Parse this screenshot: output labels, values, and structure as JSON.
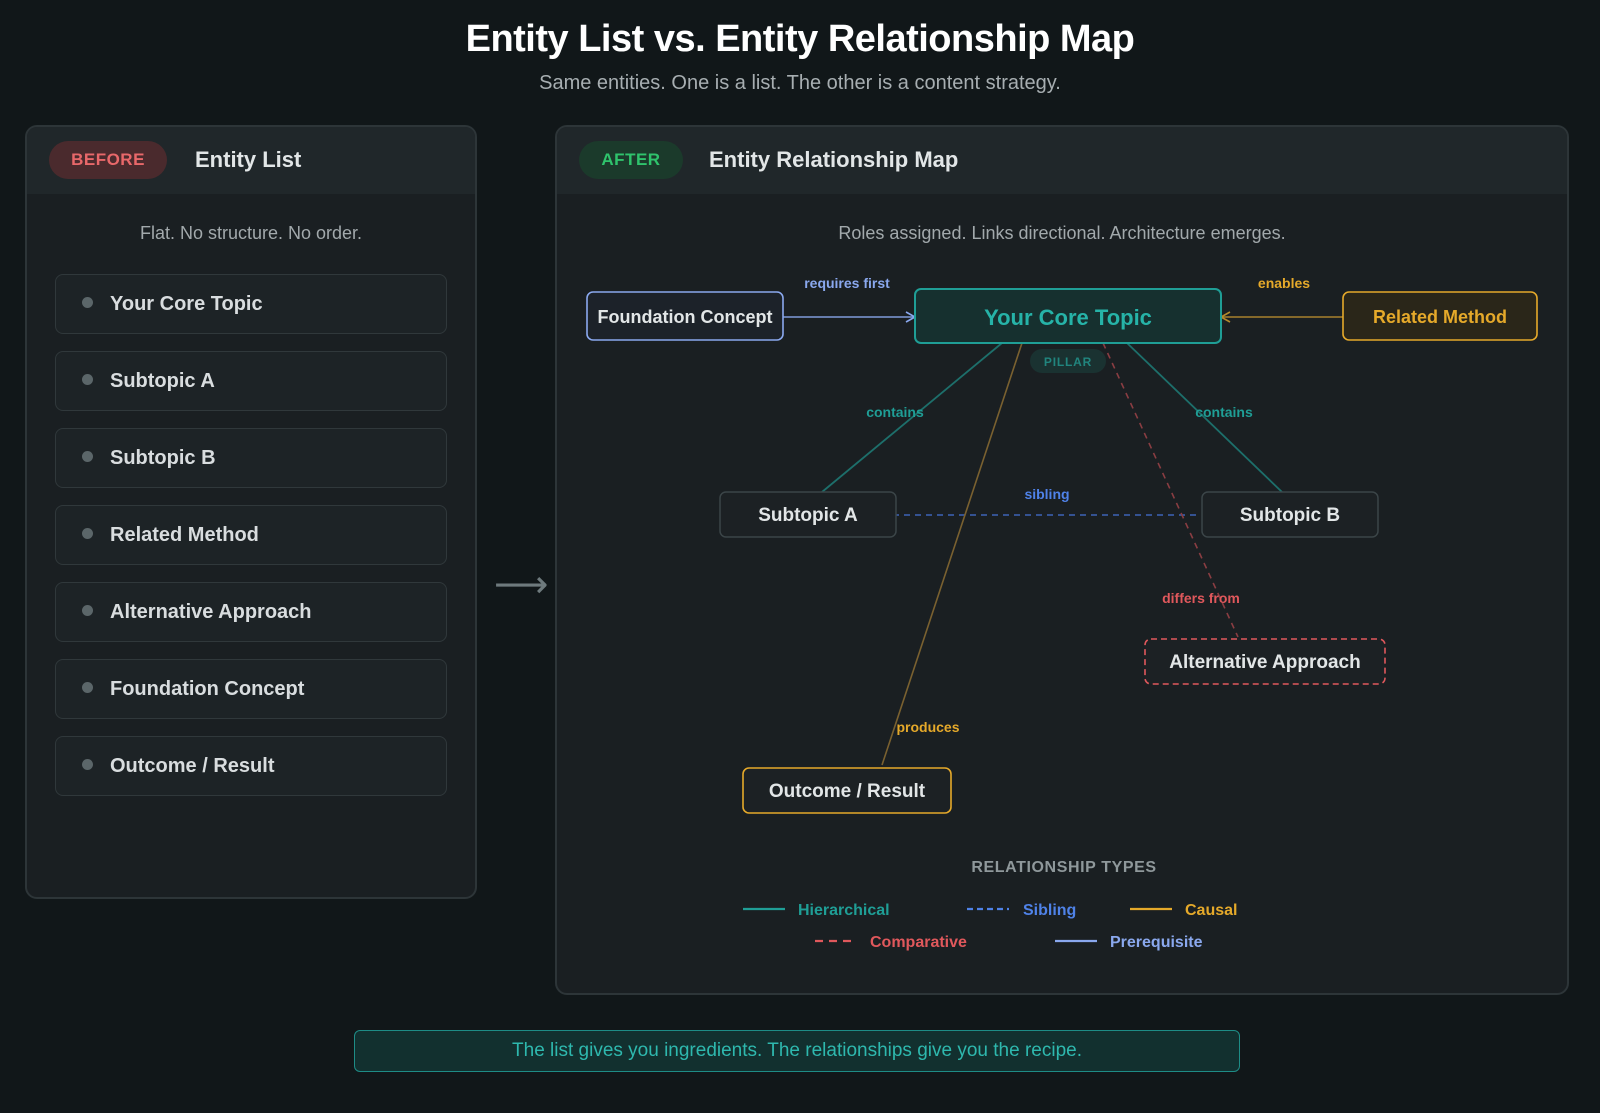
{
  "title": "Entity List vs. Entity Relationship Map",
  "subtitle": "Same entities. One is a list. The other is a content strategy.",
  "before": {
    "badge": "BEFORE",
    "title": "Entity List",
    "caption": "Flat. No structure. No order.",
    "items": [
      "Your Core Topic",
      "Subtopic A",
      "Subtopic B",
      "Related Method",
      "Alternative Approach",
      "Foundation Concept",
      "Outcome / Result"
    ]
  },
  "after": {
    "badge": "AFTER",
    "title": "Entity Relationship Map",
    "caption": "Roles assigned. Links directional. Architecture emerges.",
    "nodes": {
      "core": "Your Core Topic",
      "pillar": "PILLAR",
      "foundation": "Foundation Concept",
      "method": "Related Method",
      "sub_a": "Subtopic A",
      "sub_b": "Subtopic B",
      "alternative": "Alternative Approach",
      "outcome": "Outcome / Result"
    },
    "edge_labels": {
      "requires": "requires first",
      "enables": "enables",
      "contains_a": "contains",
      "contains_b": "contains",
      "sibling": "sibling",
      "differs": "differs from",
      "produces": "produces"
    },
    "legend": {
      "title": "RELATIONSHIP TYPES",
      "hierarchical": "Hierarchical",
      "sibling": "Sibling",
      "causal": "Causal",
      "comparative": "Comparative",
      "prerequisite": "Prerequisite"
    }
  },
  "colors": {
    "hierarchical": "#1f9e96",
    "sibling": "#4f82e8",
    "causal": "#e5a92a",
    "comparative": "#e0585c",
    "prerequisite": "#8aa8ee"
  },
  "footer": "The list gives you ingredients. The relationships give you the recipe."
}
